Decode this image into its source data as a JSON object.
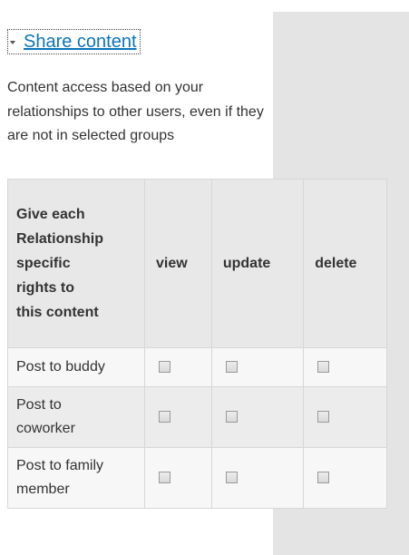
{
  "fieldset": {
    "legend": "Share content"
  },
  "description": {
    "lines": [
      "Content access based on your",
      "relationships to other users, even if they",
      "are not in selected groups"
    ]
  },
  "table": {
    "header_lines": [
      "Give each",
      "Relationship",
      "specific",
      "rights to",
      "this content"
    ],
    "columns": [
      "view",
      "update",
      "delete"
    ],
    "rows": [
      {
        "label_lines": [
          "Post to buddy"
        ]
      },
      {
        "label_lines": [
          "Post to",
          "coworker"
        ]
      },
      {
        "label_lines": [
          "Post to family",
          "member"
        ]
      }
    ]
  },
  "icons": {
    "collapse": "collapse-triangle-icon",
    "checkbox": "checkbox-icon"
  }
}
